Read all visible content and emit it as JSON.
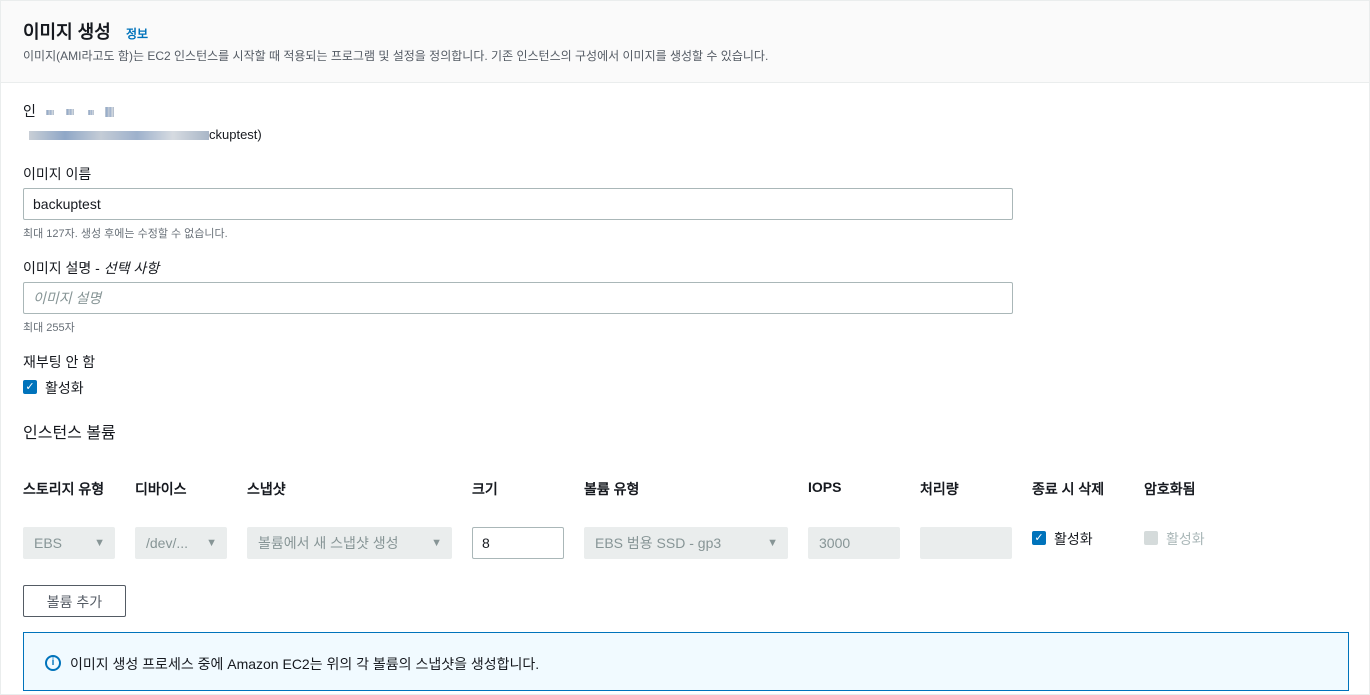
{
  "header": {
    "title": "이미지 생성",
    "info_link": "정보",
    "description": "이미지(AMI라고도 함)는 EC2 인스턴스를 시작할 때 적용되는 프로그램 및 설정을 정의합니다. 기존 인스턴스의 구성에서 이미지를 생성할 수 있습니다."
  },
  "instance": {
    "label_prefix": "인",
    "value_suffix": "ckuptest)"
  },
  "image_name": {
    "label": "이미지 이름",
    "value": "backuptest",
    "hint": "최대 127자. 생성 후에는 수정할 수 없습니다."
  },
  "image_description": {
    "label": "이미지 설명 - ",
    "label_optional": "선택 사항",
    "placeholder": "이미지 설명",
    "hint": "최대 255자"
  },
  "no_reboot": {
    "label": "재부팅 안 함",
    "checkbox_label": "활성화",
    "checked": true
  },
  "volumes": {
    "section_title": "인스턴스 볼륨",
    "columns": [
      "스토리지 유형",
      "디바이스",
      "스냅샷",
      "크기",
      "볼륨 유형",
      "IOPS",
      "처리량",
      "종료 시 삭제",
      "암호화됨"
    ],
    "row": {
      "storage_type": "EBS",
      "device": "/dev/...",
      "snapshot": "볼륨에서 새 스냅샷 생성",
      "size": "8",
      "volume_type": "EBS 범용 SSD - gp3",
      "iops": "3000",
      "throughput": "",
      "delete_on_termination_label": "활성화",
      "delete_on_termination": true,
      "encrypted_label": "활성화",
      "encrypted": false
    },
    "add_volume_button": "볼륨 추가"
  },
  "alert": {
    "icon": "info-icon",
    "text": "이미지 생성 프로세스 중에 Amazon EC2는 위의 각 볼륨의 스냅샷을 생성합니다."
  },
  "colors": {
    "accent": "#0073bb",
    "header_bg": "#fafafa",
    "alert_bg": "#f1faff",
    "disabled_bg": "#eaeded"
  }
}
